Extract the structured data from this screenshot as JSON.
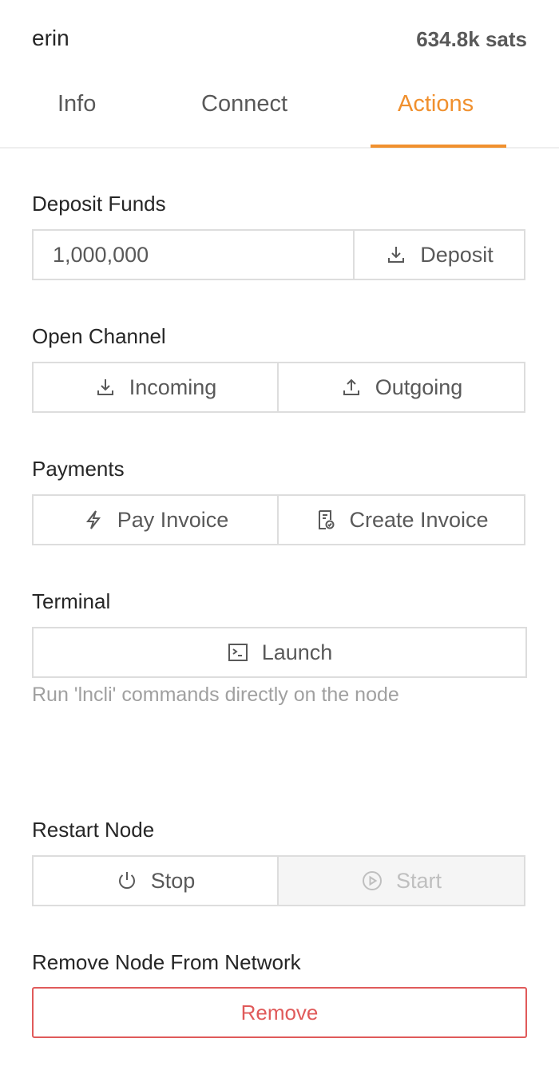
{
  "header": {
    "node_name": "erin",
    "balance": "634.8k sats"
  },
  "tabs": [
    {
      "label": "Info",
      "active": false
    },
    {
      "label": "Connect",
      "active": false
    },
    {
      "label": "Actions",
      "active": true
    }
  ],
  "deposit": {
    "label": "Deposit Funds",
    "amount_value": "1,000,000",
    "button_label": "Deposit",
    "icon": "download-icon"
  },
  "open_channel": {
    "label": "Open Channel",
    "incoming_label": "Incoming",
    "incoming_icon": "download-icon",
    "outgoing_label": "Outgoing",
    "outgoing_icon": "upload-icon"
  },
  "payments": {
    "label": "Payments",
    "pay_label": "Pay Invoice",
    "pay_icon": "lightning-icon",
    "create_label": "Create Invoice",
    "create_icon": "invoice-icon"
  },
  "terminal": {
    "label": "Terminal",
    "launch_label": "Launch",
    "launch_icon": "terminal-icon",
    "help_text": "Run 'lncli' commands directly on the node"
  },
  "restart": {
    "label": "Restart Node",
    "stop_label": "Stop",
    "stop_icon": "power-icon",
    "start_label": "Start",
    "start_icon": "play-circle-icon",
    "start_disabled": true
  },
  "remove": {
    "label": "Remove Node From Network",
    "button_label": "Remove"
  },
  "colors": {
    "accent": "#f0902e",
    "danger": "#e05a5a",
    "border": "#dddddd"
  }
}
